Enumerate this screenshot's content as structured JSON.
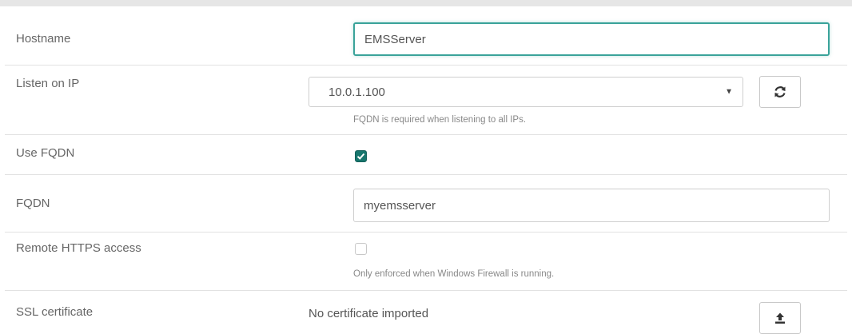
{
  "hostname": {
    "label": "Hostname",
    "value": "EMSServer"
  },
  "listen_on_ip": {
    "label": "Listen on IP",
    "selected": "10.0.1.100",
    "help": "FQDN is required when listening to all IPs.",
    "refresh_icon": "refresh-icon"
  },
  "use_fqdn": {
    "label": "Use FQDN",
    "checked": true
  },
  "fqdn": {
    "label": "FQDN",
    "value": "myemsserver"
  },
  "remote_https": {
    "label": "Remote HTTPS access",
    "checked": false,
    "help": "Only enforced when Windows Firewall is running."
  },
  "ssl_certificate": {
    "label": "SSL certificate",
    "status": "No certificate imported",
    "upload_icon": "upload-icon"
  },
  "colors": {
    "accent": "#3aa39a",
    "checkbox_checked": "#17766d"
  }
}
